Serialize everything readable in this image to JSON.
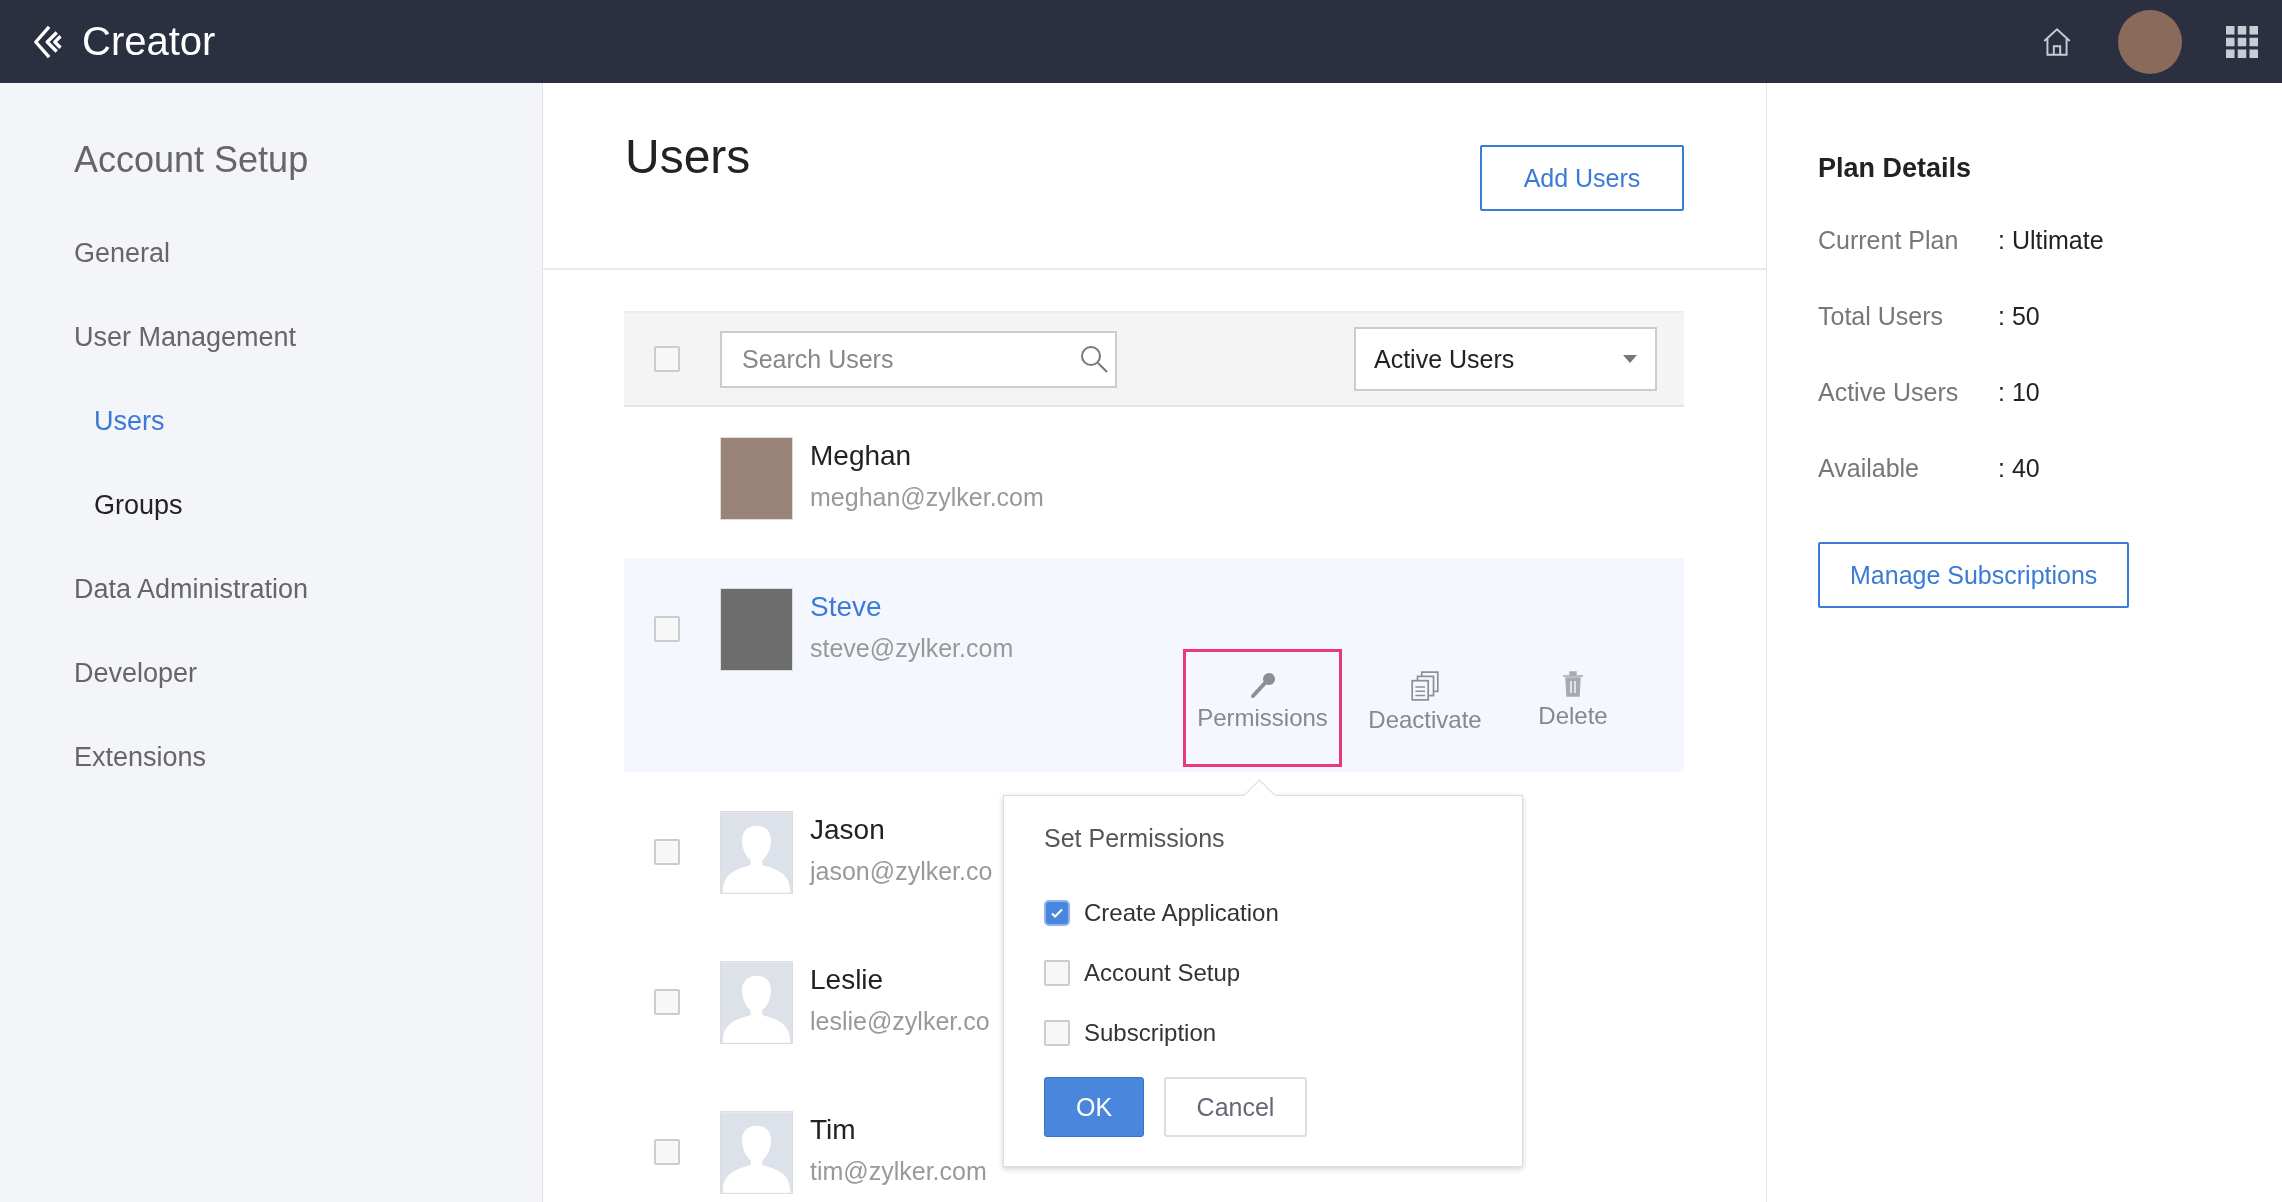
{
  "topbar": {
    "app_name": "Creator"
  },
  "sidebar": {
    "title": "Account Setup",
    "items": [
      {
        "label": "General",
        "selected": false
      },
      {
        "label": "User Management",
        "selected": false,
        "children": [
          {
            "label": "Users",
            "selected": true
          },
          {
            "label": "Groups",
            "selected": false
          }
        ]
      },
      {
        "label": "Data Administration",
        "selected": false
      },
      {
        "label": "Developer",
        "selected": false
      },
      {
        "label": "Extensions",
        "selected": false
      }
    ]
  },
  "main": {
    "title": "Users",
    "add_button": "Add Users",
    "toolbar": {
      "select_all_checked": false,
      "search": {
        "placeholder": "Search Users"
      },
      "filter": {
        "value": "Active Users"
      }
    },
    "users": [
      {
        "name": "Meghan",
        "email": "meghan@zylker.com",
        "kind": "photo",
        "highlighted": false
      },
      {
        "name": "Steve",
        "email": "steve@zylker.com",
        "kind": "photo",
        "checked": false,
        "highlighted": true,
        "actions": [
          {
            "kind": "permissions",
            "label": "Permissions",
            "highlighted": true
          },
          {
            "kind": "deactivate",
            "label": "Deactivate",
            "highlighted": false
          },
          {
            "kind": "delete",
            "label": "Delete",
            "highlighted": false
          }
        ]
      },
      {
        "name": "Jason",
        "email": "jason@zylker.co",
        "kind": "default",
        "checked": false,
        "highlighted": false
      },
      {
        "name": "Leslie",
        "email": "leslie@zylker.co",
        "kind": "default",
        "checked": false,
        "highlighted": false
      },
      {
        "name": "Tim",
        "email": "tim@zylker.com",
        "kind": "default",
        "checked": false,
        "highlighted": false
      }
    ],
    "permissions_popup": {
      "title": "Set Permissions",
      "options": [
        {
          "label": "Create Application",
          "checked": true
        },
        {
          "label": "Account Setup",
          "checked": false
        },
        {
          "label": "Subscription",
          "checked": false
        }
      ],
      "ok": "OK",
      "cancel": "Cancel"
    }
  },
  "plan": {
    "title": "Plan Details",
    "rows": [
      {
        "label": "Current Plan",
        "value": ": Ultimate"
      },
      {
        "label": "Total Users",
        "value": ": 50"
      },
      {
        "label": "Active Users",
        "value": ": 10"
      },
      {
        "label": "Available",
        "value": ": 40"
      }
    ],
    "button": "Manage Subscriptions"
  }
}
